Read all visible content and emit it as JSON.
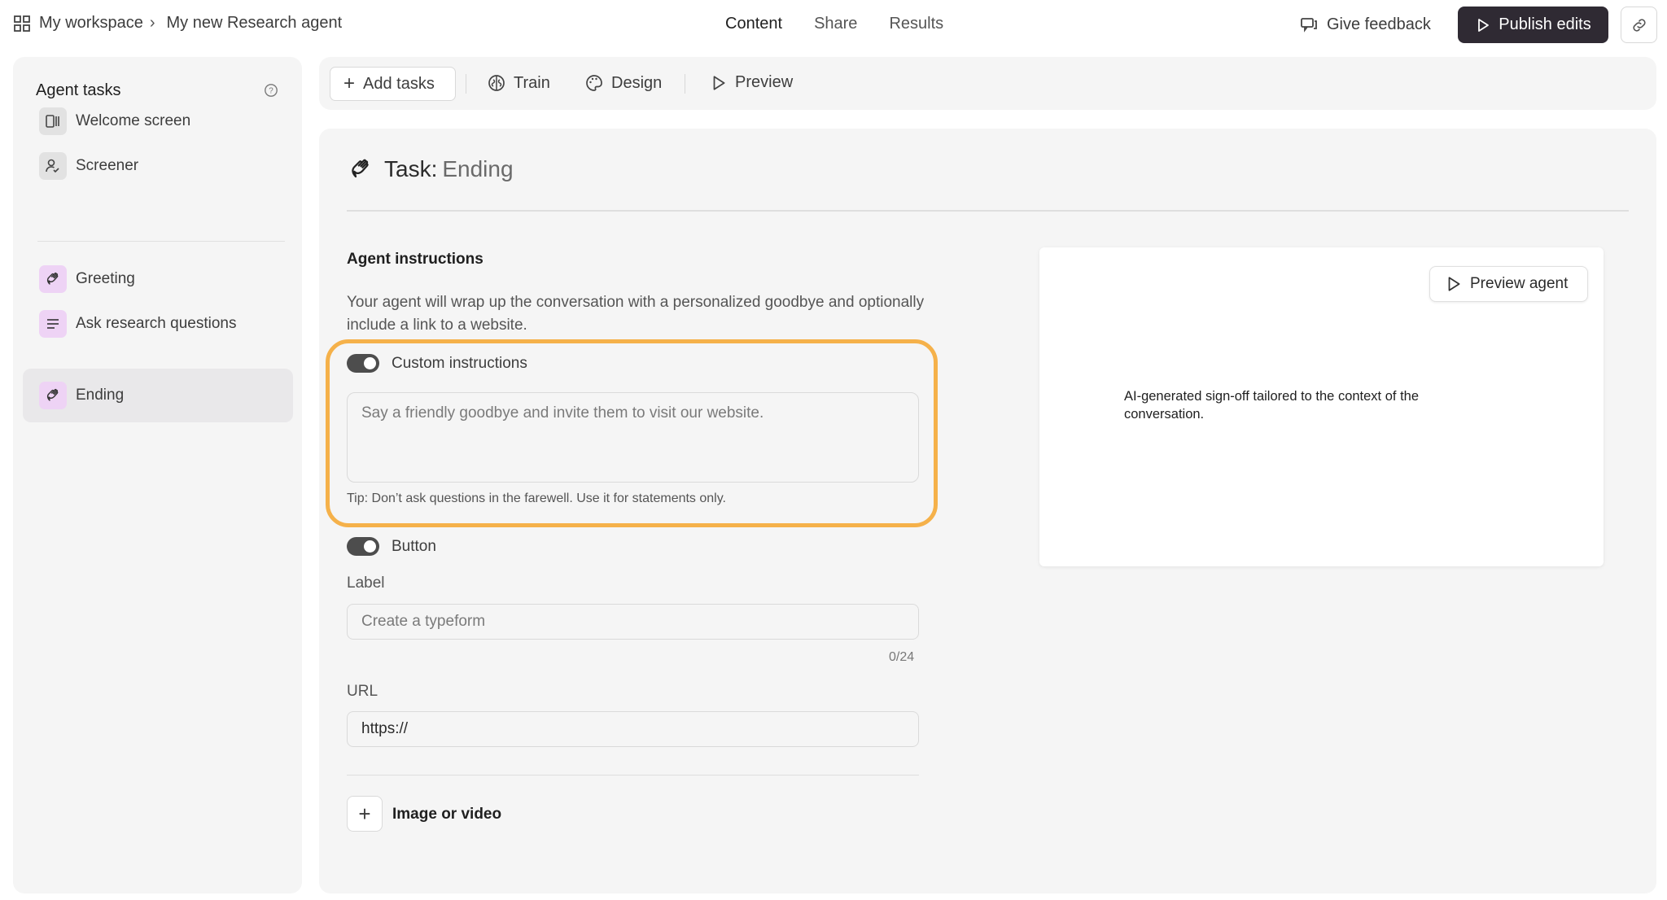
{
  "header": {
    "workspace": "My workspace",
    "agent_name": "My new Research agent",
    "tabs": [
      {
        "label": "Content",
        "active": true
      },
      {
        "label": "Share",
        "active": false
      },
      {
        "label": "Results",
        "active": false
      }
    ],
    "feedback_label": "Give feedback",
    "publish_label": "Publish edits",
    "icons": {
      "workspace": "grid-icon",
      "breadcrumb": "chevron-right-icon",
      "feedback": "feedback-icon",
      "publish": "play-icon",
      "link": "link-icon"
    }
  },
  "sidebar": {
    "title": "Agent tasks",
    "items": [
      {
        "label": "Welcome screen",
        "icon": "welcome-screen-icon",
        "active": false
      },
      {
        "label": "Screener",
        "icon": "user-check-icon",
        "active": false
      },
      {
        "label": "Greeting",
        "icon": "wave-hand-icon",
        "active": false
      },
      {
        "label": "Ask research questions",
        "icon": "text-lines-icon",
        "active": false
      },
      {
        "label": "Ending",
        "icon": "wave-hand-icon",
        "active": true
      }
    ]
  },
  "toolbar": {
    "add_label": "Add tasks",
    "train_label": "Train",
    "design_label": "Design",
    "preview_label": "Preview"
  },
  "task": {
    "prefix": "Task:",
    "name": "Ending",
    "section_title": "Agent instructions",
    "description": "Your agent will wrap up the conversation with a personalized goodbye and optionally include a link to a website.",
    "custom_instructions": {
      "label": "Custom instructions",
      "enabled": true,
      "placeholder": "Say a friendly goodbye and invite them to visit our website.",
      "tip": "Tip: Don’t ask questions in the farewell. Use it for statements only."
    },
    "button": {
      "label": "Button",
      "enabled": true,
      "label_field_title": "Label",
      "label_placeholder": "Create a typeform",
      "counter": "0/24",
      "url_field_title": "URL",
      "url_value": "https://"
    },
    "media_label": "Image or video"
  },
  "preview": {
    "button_label": "Preview agent",
    "text": "AI-generated sign-off tailored to the context of the conversation."
  },
  "colors": {
    "highlight": "#f5b14a",
    "publish_bg": "#2f2a33",
    "task_icon_bg": "#eed3f5"
  }
}
